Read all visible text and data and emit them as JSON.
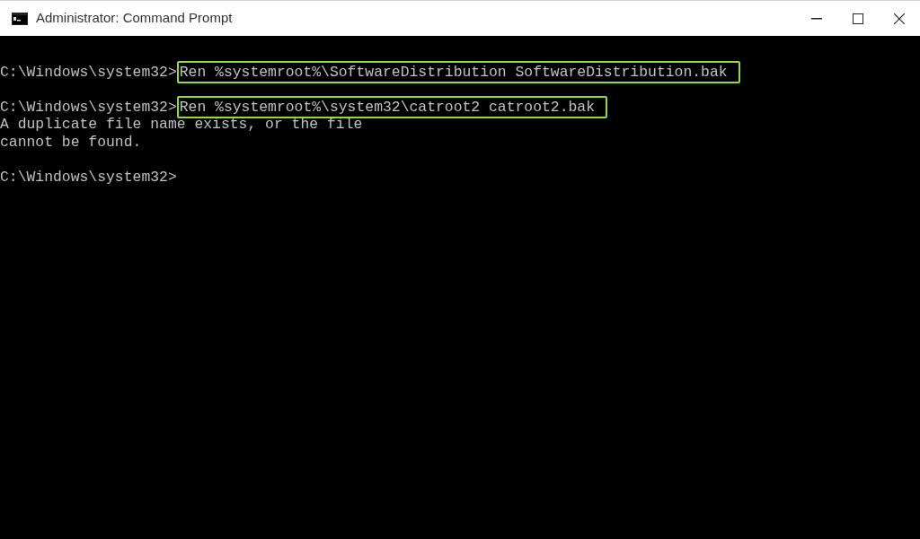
{
  "window": {
    "title": "Administrator: Command Prompt"
  },
  "console": {
    "lines": [
      {
        "kind": "blank"
      },
      {
        "kind": "command",
        "prompt": "C:\\Windows\\system32>",
        "command": "Ren %systemroot%\\SoftwareDistribution SoftwareDistribution.bak",
        "highlighted": true
      },
      {
        "kind": "blank"
      },
      {
        "kind": "command",
        "prompt": "C:\\Windows\\system32>",
        "command": "Ren %systemroot%\\system32\\catroot2 catroot2.bak",
        "highlighted": true
      },
      {
        "kind": "output",
        "text": "A duplicate file name exists, or the file"
      },
      {
        "kind": "output",
        "text": "cannot be found."
      },
      {
        "kind": "blank"
      },
      {
        "kind": "command",
        "prompt": "C:\\Windows\\system32>"
      }
    ]
  }
}
